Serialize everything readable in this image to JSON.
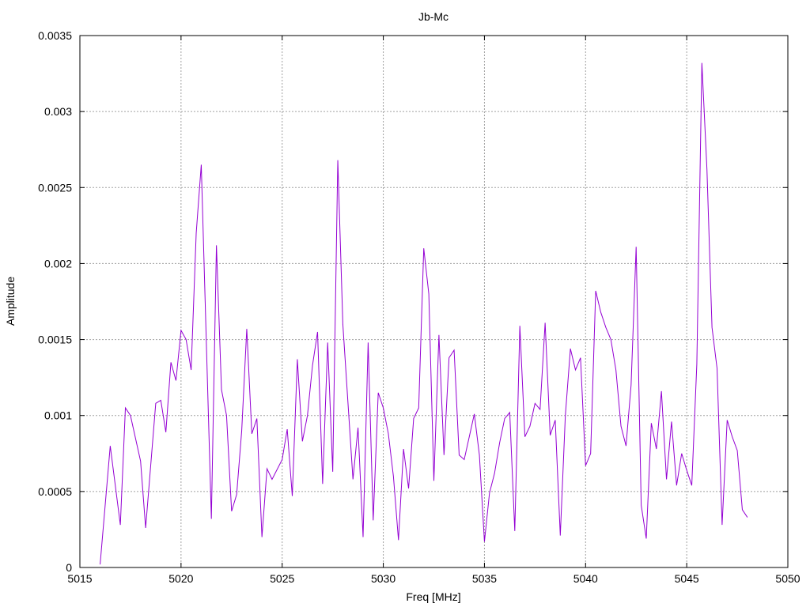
{
  "chart_data": {
    "type": "line",
    "title": "Jb-Mc",
    "xlabel": "Freq [MHz]",
    "ylabel": "Amplitude",
    "xlim": [
      5015,
      5050
    ],
    "ylim": [
      0,
      0.0035
    ],
    "xticks": [
      5015,
      5020,
      5025,
      5030,
      5035,
      5040,
      5045,
      5050
    ],
    "yticks": [
      0,
      0.0005,
      0.001,
      0.0015,
      0.002,
      0.0025,
      0.003,
      0.0035
    ],
    "ytick_labels": [
      "0",
      "0.0005",
      "0.001",
      "0.0015",
      "0.002",
      "0.0025",
      "0.003",
      "0.0035"
    ],
    "grid": true,
    "series": [
      {
        "color": "#9400d3",
        "x": [
          5016.0,
          5016.5,
          5017.0,
          5017.25,
          5017.5,
          5018.0,
          5018.25,
          5018.75,
          5019.0,
          5019.25,
          5019.5,
          5019.75,
          5020.0,
          5020.25,
          5020.5,
          5020.75,
          5021.0,
          5021.5,
          5021.75,
          5022.0,
          5022.25,
          5022.5,
          5022.75,
          5023.0,
          5023.25,
          5023.5,
          5023.75,
          5024.0,
          5024.25,
          5024.5,
          5025.0,
          5025.25,
          5025.5,
          5025.75,
          5026.0,
          5026.25,
          5026.5,
          5026.75,
          5027.0,
          5027.25,
          5027.5,
          5027.75,
          5028.0,
          5028.5,
          5028.75,
          5029.0,
          5029.25,
          5029.5,
          5029.75,
          5030.0,
          5030.25,
          5030.5,
          5030.75,
          5031.0,
          5031.25,
          5031.5,
          5031.75,
          5032.0,
          5032.25,
          5032.5,
          5032.75,
          5033.0,
          5033.25,
          5033.5,
          5033.75,
          5034.0,
          5034.25,
          5034.5,
          5034.75,
          5035.0,
          5035.25,
          5035.5,
          5035.75,
          5036.0,
          5036.25,
          5036.5,
          5036.75,
          5037.0,
          5037.25,
          5037.5,
          5037.75,
          5038.0,
          5038.25,
          5038.5,
          5038.75,
          5039.0,
          5039.25,
          5039.5,
          5039.75,
          5040.0,
          5040.25,
          5040.5,
          5040.75,
          5041.0,
          5041.25,
          5041.5,
          5041.75,
          5042.0,
          5042.25,
          5042.5,
          5042.75,
          5043.0,
          5043.25,
          5043.5,
          5043.75,
          5044.0,
          5044.25,
          5044.5,
          5044.75,
          5045.0,
          5045.25,
          5045.5,
          5045.75,
          5046.0,
          5046.25,
          5046.5,
          5046.75,
          5047.0,
          5047.25,
          5047.5,
          5047.75,
          5048.0
        ],
        "y": [
          2e-05,
          0.0008,
          0.00028,
          0.00105,
          0.001,
          0.0007,
          0.00026,
          0.00108,
          0.0011,
          0.00089,
          0.00135,
          0.00123,
          0.00156,
          0.0015,
          0.0013,
          0.0022,
          0.00265,
          0.00032,
          0.00212,
          0.00117,
          0.001,
          0.00037,
          0.00048,
          0.0009,
          0.00157,
          0.00088,
          0.00098,
          0.0002,
          0.00065,
          0.00058,
          0.00071,
          0.00091,
          0.00047,
          0.00137,
          0.00083,
          0.001,
          0.00133,
          0.00155,
          0.00055,
          0.00148,
          0.00063,
          0.00268,
          0.0016,
          0.00058,
          0.00092,
          0.0002,
          0.00148,
          0.00031,
          0.00115,
          0.00105,
          0.00088,
          0.0006,
          0.00018,
          0.00078,
          0.00052,
          0.00098,
          0.00105,
          0.0021,
          0.0018,
          0.00057,
          0.00153,
          0.00074,
          0.00138,
          0.00143,
          0.00074,
          0.00071,
          0.00086,
          0.00101,
          0.00074,
          0.00017,
          0.00049,
          0.00062,
          0.00082,
          0.00098,
          0.00102,
          0.00024,
          0.00159,
          0.00086,
          0.00093,
          0.00108,
          0.00104,
          0.00161,
          0.00087,
          0.00097,
          0.00021,
          0.001,
          0.00144,
          0.0013,
          0.00138,
          0.00067,
          0.00075,
          0.00182,
          0.00168,
          0.00158,
          0.0015,
          0.0013,
          0.00093,
          0.0008,
          0.0012,
          0.00211,
          0.00041,
          0.00019,
          0.00095,
          0.00078,
          0.00116,
          0.00058,
          0.00096,
          0.00054,
          0.00075,
          0.00064,
          0.00054,
          0.00134,
          0.00332,
          0.00262,
          0.00158,
          0.00131,
          0.00028,
          0.00097,
          0.00086,
          0.00077,
          0.00038,
          0.00033
        ]
      }
    ]
  }
}
